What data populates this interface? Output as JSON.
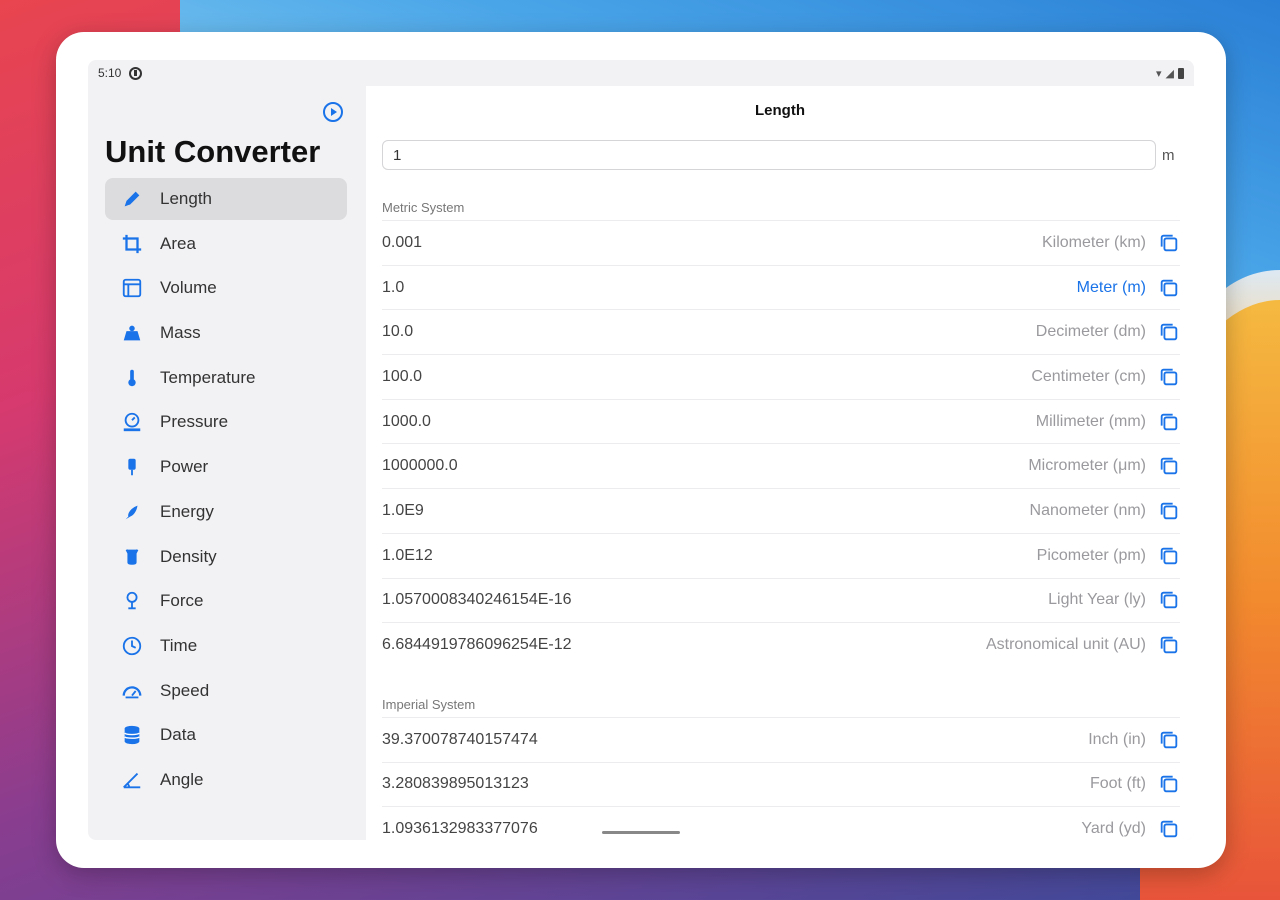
{
  "status": {
    "time": "5:10"
  },
  "sidebar": {
    "title": "Unit Converter",
    "items": [
      {
        "label": "Length",
        "icon": "ruler-pencil-icon",
        "active": true
      },
      {
        "label": "Area",
        "icon": "crop-icon"
      },
      {
        "label": "Volume",
        "icon": "cube-icon"
      },
      {
        "label": "Mass",
        "icon": "weight-icon"
      },
      {
        "label": "Temperature",
        "icon": "thermometer-icon"
      },
      {
        "label": "Pressure",
        "icon": "gauge-icon"
      },
      {
        "label": "Power",
        "icon": "bolt-plug-icon"
      },
      {
        "label": "Energy",
        "icon": "flame-icon"
      },
      {
        "label": "Density",
        "icon": "beaker-icon"
      },
      {
        "label": "Force",
        "icon": "force-icon"
      },
      {
        "label": "Time",
        "icon": "clock-icon"
      },
      {
        "label": "Speed",
        "icon": "speedometer-icon"
      },
      {
        "label": "Data",
        "icon": "database-icon"
      },
      {
        "label": "Angle",
        "icon": "angle-icon"
      }
    ]
  },
  "main": {
    "title": "Length",
    "input_value": "1",
    "input_unit": "m",
    "sections": [
      {
        "header": "Metric System",
        "rows": [
          {
            "value": "0.001",
            "unit": "Kilometer (km)"
          },
          {
            "value": "1.0",
            "unit": "Meter (m)",
            "selected": true
          },
          {
            "value": "10.0",
            "unit": "Decimeter (dm)"
          },
          {
            "value": "100.0",
            "unit": "Centimeter (cm)"
          },
          {
            "value": "1000.0",
            "unit": "Millimeter (mm)"
          },
          {
            "value": "1000000.0",
            "unit": "Micrometer (μm)"
          },
          {
            "value": "1.0E9",
            "unit": "Nanometer (nm)"
          },
          {
            "value": "1.0E12",
            "unit": "Picometer (pm)"
          },
          {
            "value": "1.0570008340246154E-16",
            "unit": "Light Year (ly)"
          },
          {
            "value": "6.684491978609625​4E-12",
            "unit": "Astronomical unit (AU)"
          }
        ]
      },
      {
        "header": "Imperial System",
        "rows": [
          {
            "value": "39.370078740157474",
            "unit": "Inch (in)"
          },
          {
            "value": "3.280839895013123",
            "unit": "Foot (ft)"
          },
          {
            "value": "1.0936132983377076",
            "unit": "Yard (yd)"
          }
        ]
      }
    ]
  },
  "colors": {
    "accent": "#1a73e8",
    "selected_bg": "#dcdcdf"
  }
}
